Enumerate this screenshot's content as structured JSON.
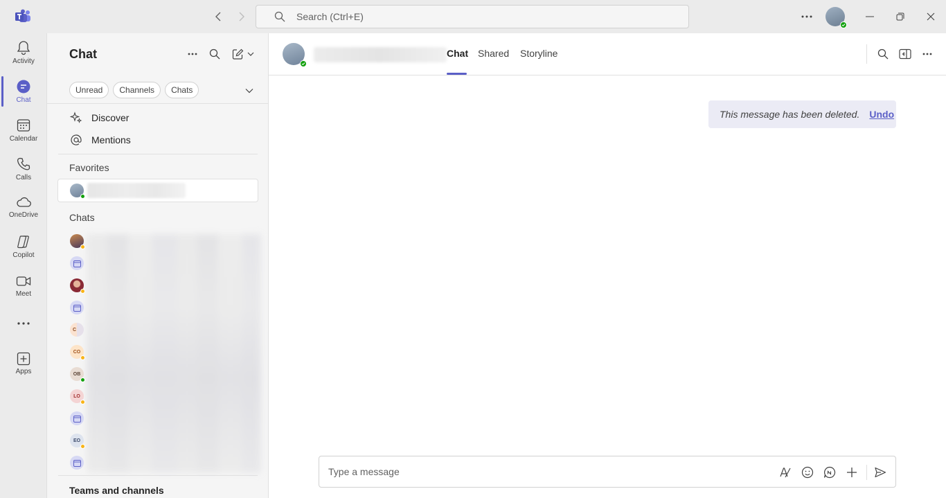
{
  "titlebar": {
    "search_placeholder": "Search (Ctrl+E)"
  },
  "rail": {
    "items": [
      {
        "label": "Activity",
        "icon": "bell-icon"
      },
      {
        "label": "Chat",
        "icon": "chat-icon",
        "active": true
      },
      {
        "label": "Calendar",
        "icon": "calendar-icon"
      },
      {
        "label": "Calls",
        "icon": "phone-icon"
      },
      {
        "label": "OneDrive",
        "icon": "cloud-icon"
      },
      {
        "label": "Copilot",
        "icon": "copilot-icon"
      },
      {
        "label": "Meet",
        "icon": "video-icon"
      },
      {
        "label": "Apps",
        "icon": "add-apps-icon"
      }
    ]
  },
  "pane": {
    "title": "Chat",
    "filters": [
      "Unread",
      "Channels",
      "Chats"
    ],
    "nav": [
      {
        "label": "Discover",
        "icon": "sparkle-icon"
      },
      {
        "label": "Mentions",
        "icon": "at-icon"
      }
    ],
    "favorites_heading": "Favorites",
    "chats_heading": "Chats",
    "chat_avatars": [
      {
        "type": "photo",
        "status": "away"
      },
      {
        "type": "meeting"
      },
      {
        "type": "photo",
        "status": "away"
      },
      {
        "type": "meeting"
      },
      {
        "type": "group",
        "initials": "C"
      },
      {
        "type": "initials",
        "initials": "CO",
        "status": "away"
      },
      {
        "type": "initials",
        "initials": "OB",
        "status": "available"
      },
      {
        "type": "initials",
        "initials": "LO",
        "status": "away"
      },
      {
        "type": "meeting"
      },
      {
        "type": "initials",
        "initials": "EO",
        "status": "away"
      },
      {
        "type": "meeting"
      }
    ],
    "teams_heading": "Teams and channels"
  },
  "main": {
    "tabs": [
      {
        "label": "Chat",
        "active": true
      },
      {
        "label": "Shared"
      },
      {
        "label": "Storyline"
      }
    ],
    "deleted_message": "This message has been deleted.",
    "undo_label": "Undo",
    "composer_placeholder": "Type a message"
  },
  "colors": {
    "accent": "#5b5fc7",
    "available": "#13a10e",
    "away": "#f8b418",
    "rail_bg": "#ebebeb",
    "pane_bg": "#f5f5f5",
    "deleted_bg": "#ebebf5"
  }
}
